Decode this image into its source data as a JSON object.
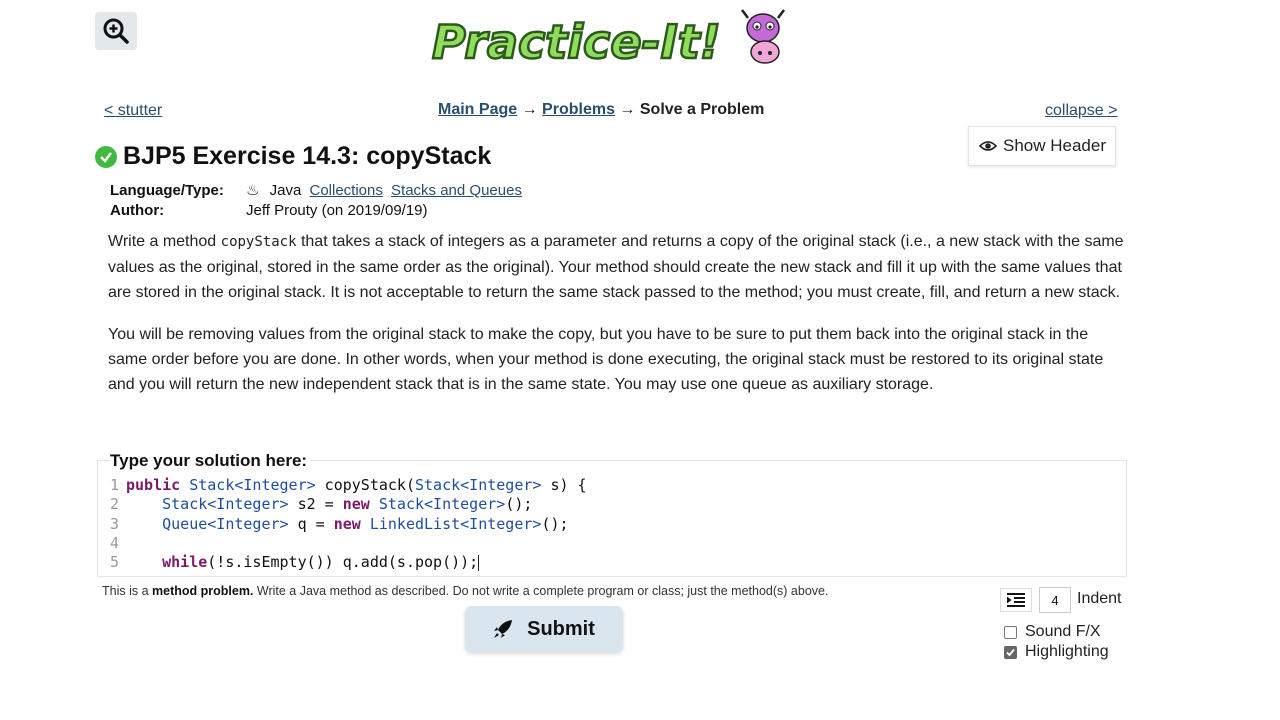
{
  "header": {
    "zoom_icon": "zoom-in-icon",
    "logo_text": "Practice-It!"
  },
  "nav": {
    "prev_link": "< stutter",
    "breadcrumb": [
      "Main Page",
      "Problems",
      "Solve a Problem"
    ],
    "arrow": "→",
    "collapse_link": "collapse >"
  },
  "show_header_label": "Show Header",
  "problem": {
    "title": "BJP5 Exercise 14.3: copyStack",
    "status": "solved",
    "language_label": "Language/Type:",
    "language": "Java",
    "tags": [
      "Collections",
      "Stacks and Queues"
    ],
    "author_label": "Author:",
    "author": "Jeff Prouty (on 2019/09/19)",
    "desc_p1_before": "Write a method ",
    "desc_p1_code": "copyStack",
    "desc_p1_after": " that takes a stack of integers as a parameter and returns a copy of the original stack (i.e., a new stack with the same values as the original, stored in the same order as the original). Your method should create the new stack and fill it up with the same values that are stored in the original stack. It is not acceptable to return the same stack passed to the method; you must create, fill, and return a new stack.",
    "desc_p2": "You will be removing values from the original stack to make the copy, but you have to be sure to put them back into the original stack in the same order before you are done. In other words, when your method is done executing, the original stack must be restored to its original state and you will return the new independent stack that is in the same state. You may use one queue as auxiliary storage."
  },
  "editor": {
    "label": "Type your solution here:",
    "lines": [
      "public Stack<Integer> copyStack(Stack<Integer> s) {",
      "    Stack<Integer> s2 = new Stack<Integer>();",
      "    Queue<Integer> q = new LinkedList<Integer>();",
      "",
      "    while(!s.isEmpty()) q.add(s.pop());"
    ],
    "line_numbers": [
      "1",
      "2",
      "3",
      "4",
      "5"
    ]
  },
  "hint": {
    "prefix": "This is a ",
    "bold": "method problem.",
    "suffix": " Write a Java method as described. Do not write a complete program or class; just the method(s) above."
  },
  "submit_label": "Submit",
  "indent": {
    "value": "4",
    "label": "Indent"
  },
  "options": [
    {
      "label": "Sound F/X",
      "checked": false
    },
    {
      "label": "Highlighting",
      "checked": true
    }
  ],
  "colors": {
    "link": "#2a4d6e",
    "check": "#3fba3f",
    "submit_bg": "#d9e6ef",
    "keyword": "#7a1a6a",
    "type": "#1e4d9e"
  }
}
